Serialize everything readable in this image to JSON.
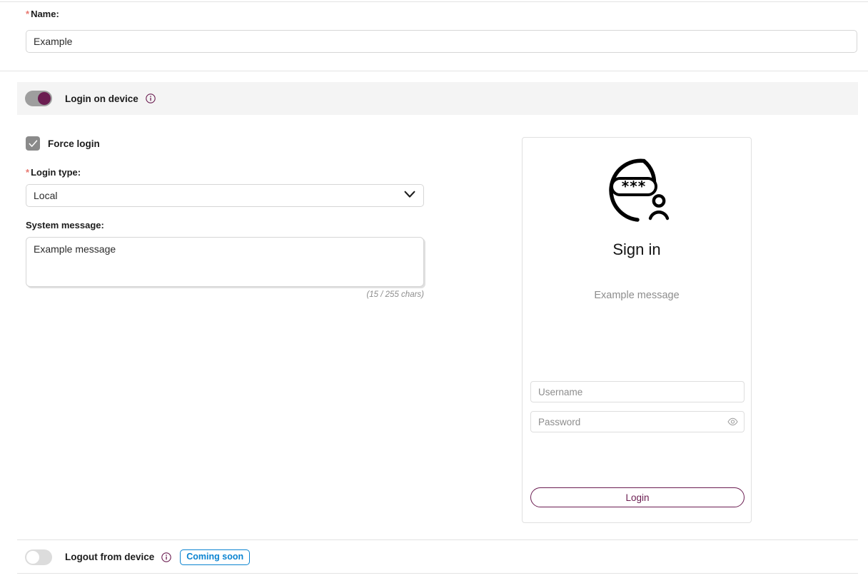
{
  "name_field": {
    "label": "Name:",
    "required_marker": "*",
    "value": "Example"
  },
  "login_on_device": {
    "label": "Login on device",
    "toggle_state": "on",
    "info_icon": "info-circle-icon"
  },
  "force_login": {
    "label": "Force login",
    "checked": true
  },
  "login_type": {
    "label": "Login type:",
    "required_marker": "*",
    "selected": "Local",
    "options": [
      "Local"
    ]
  },
  "system_message": {
    "label": "System message:",
    "value": "Example message",
    "char_count": "(15 / 255 chars)"
  },
  "preview": {
    "icon": "password-user-circle-icon",
    "asterisks": "***",
    "title": "Sign in",
    "message": "Example message",
    "username_placeholder": "Username",
    "username_value": "",
    "password_placeholder": "Password",
    "password_value": "",
    "show_password_icon": "eye-icon",
    "login_button": "Login"
  },
  "logout_from_device": {
    "label": "Logout from device",
    "toggle_state": "off",
    "info_icon": "info-circle-icon",
    "badge": "Coming soon"
  },
  "colors": {
    "accent_purple": "#6b1d51",
    "badge_blue": "#0b84d1",
    "required_red": "#e8776f",
    "bar_gray": "#f4f4f4",
    "muted_text": "#8d8d8d"
  }
}
